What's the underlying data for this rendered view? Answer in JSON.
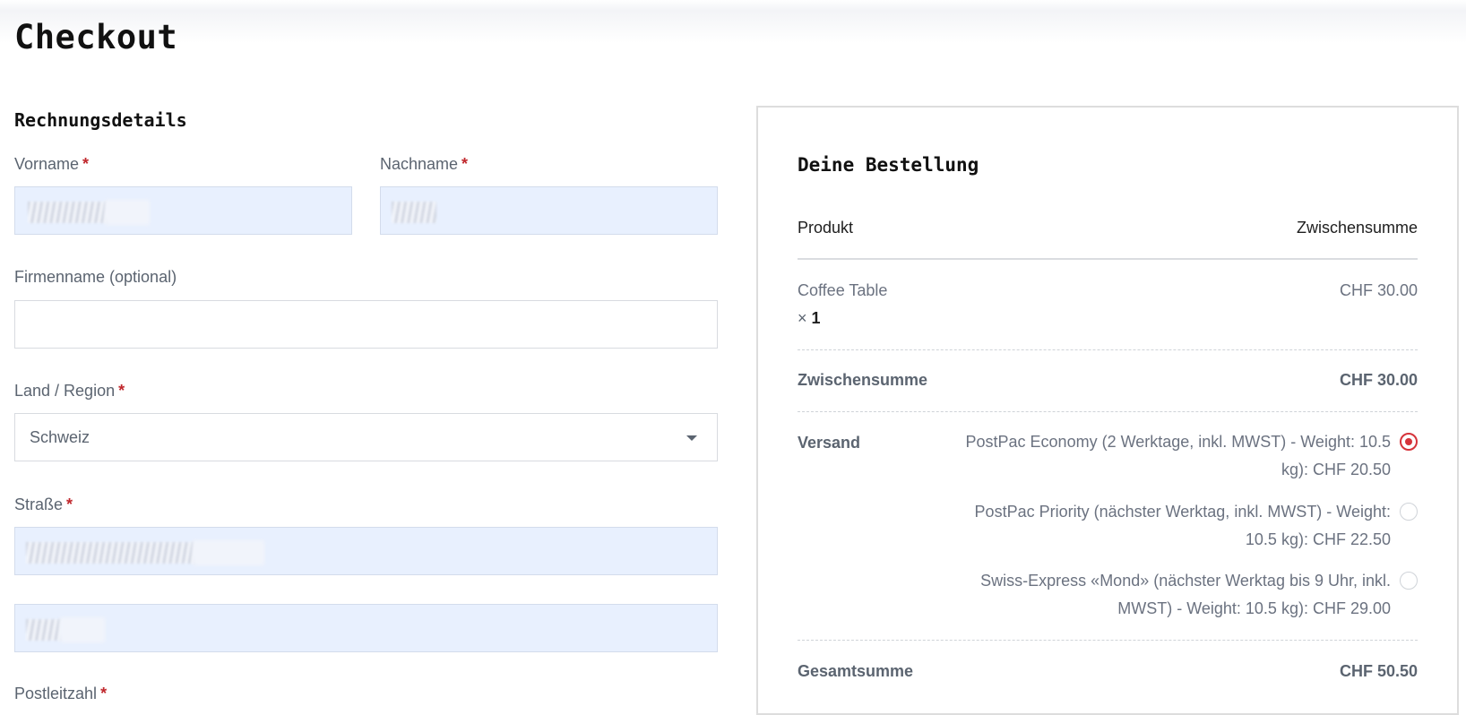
{
  "page": {
    "title": "Checkout"
  },
  "billing": {
    "section_title": "Rechnungsdetails",
    "required_mark": "*",
    "first_name": {
      "label": "Vorname"
    },
    "last_name": {
      "label": "Nachname"
    },
    "company": {
      "label": "Firmenname (optional)",
      "value": ""
    },
    "country": {
      "label": "Land / Region",
      "value": "Schweiz"
    },
    "street": {
      "label": "Straße"
    },
    "postcode": {
      "label": "Postleitzahl"
    }
  },
  "order": {
    "title": "Deine Bestellung",
    "col_product": "Produkt",
    "col_subtotal": "Zwischensumme",
    "items": [
      {
        "name": "Coffee Table",
        "qty_prefix": "×",
        "qty": "1",
        "price": "CHF 30.00"
      }
    ],
    "subtotal": {
      "label": "Zwischensumme",
      "value": "CHF 30.00"
    },
    "shipping": {
      "label": "Versand",
      "options": [
        {
          "line1": "PostPac Economy (2 Werktage, inkl. MWST) - Weight: 10.5",
          "line2": "kg): CHF 20.50",
          "selected": true
        },
        {
          "line1": "PostPac Priority (nächster Werktag, inkl. MWST) - Weight:",
          "line2": "10.5 kg): CHF 22.50",
          "selected": false
        },
        {
          "line1": "Swiss-Express «Mond» (nächster Werktag bis 9 Uhr, inkl.",
          "line2": "MWST) - Weight: 10.5 kg): CHF 29.00",
          "selected": false
        }
      ]
    },
    "total": {
      "label": "Gesamtsumme",
      "value": "CHF 50.50"
    }
  },
  "colors": {
    "accent": "#d6333a",
    "autofill": "#e8f0fe"
  }
}
